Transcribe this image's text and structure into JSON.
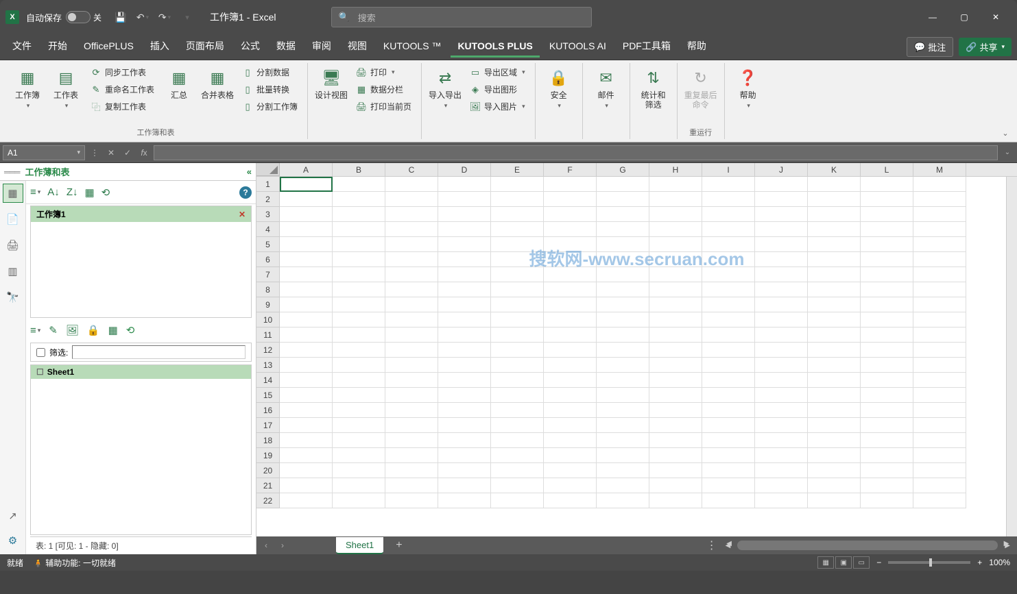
{
  "titlebar": {
    "autosave_label": "自动保存",
    "autosave_state": "关",
    "title": "工作簿1 - Excel",
    "search_placeholder": "搜索"
  },
  "tabs": {
    "file": "文件",
    "home": "开始",
    "officeplus": "OfficePLUS",
    "insert": "插入",
    "layout": "页面布局",
    "formula": "公式",
    "data": "数据",
    "review": "审阅",
    "view": "视图",
    "kutools": "KUTOOLS ™",
    "kutoolsplus": "KUTOOLS PLUS",
    "kutoolsai": "KUTOOLS AI",
    "pdfbox": "PDF工具箱",
    "help": "帮助",
    "comments": "批注",
    "share": "共享"
  },
  "ribbon": {
    "workbook": "工作簿",
    "worksheet": "工作表",
    "sync_ws": "同步工作表",
    "rename_ws": "重命名工作表",
    "copy_ws": "复制工作表",
    "summary": "汇总",
    "merge_tables": "合并表格",
    "split_data": "分割数据",
    "batch_convert": "批量转换",
    "split_wb": "分割工作簿",
    "group1_label": "工作簿和表",
    "design_view": "设计视图",
    "print": "打印",
    "data_columns": "数据分栏",
    "print_current": "打印当前页",
    "import_export": "导入导出",
    "export_area": "导出区域",
    "export_shape": "导出图形",
    "import_pic": "导入图片",
    "security": "安全",
    "mail": "邮件",
    "stats_filter": "统计和\n筛选",
    "redo_last": "重复最后\n命令",
    "redo_group": "重运行",
    "help_btn": "帮助"
  },
  "formulabar": {
    "namebox": "A1"
  },
  "sidepanel": {
    "title": "工作薄和表",
    "workbook_item": "工作簿1",
    "filter_label": "筛选:",
    "sheet_item": "Sheet1",
    "status": "表: 1  [可见: 1 - 隐藏: 0]"
  },
  "grid": {
    "cols": [
      "A",
      "B",
      "C",
      "D",
      "E",
      "F",
      "G",
      "H",
      "I",
      "J",
      "K",
      "L",
      "M"
    ],
    "rows": [
      "1",
      "2",
      "3",
      "4",
      "5",
      "6",
      "7",
      "8",
      "9",
      "10",
      "11",
      "12",
      "13",
      "14",
      "15",
      "16",
      "17",
      "18",
      "19",
      "20",
      "21",
      "22"
    ],
    "watermark": "搜软网-www.secruan.com"
  },
  "sheetbar": {
    "sheet1": "Sheet1"
  },
  "statusbar": {
    "ready": "就绪",
    "accessibility": "辅助功能: 一切就绪",
    "zoom": "100%"
  }
}
